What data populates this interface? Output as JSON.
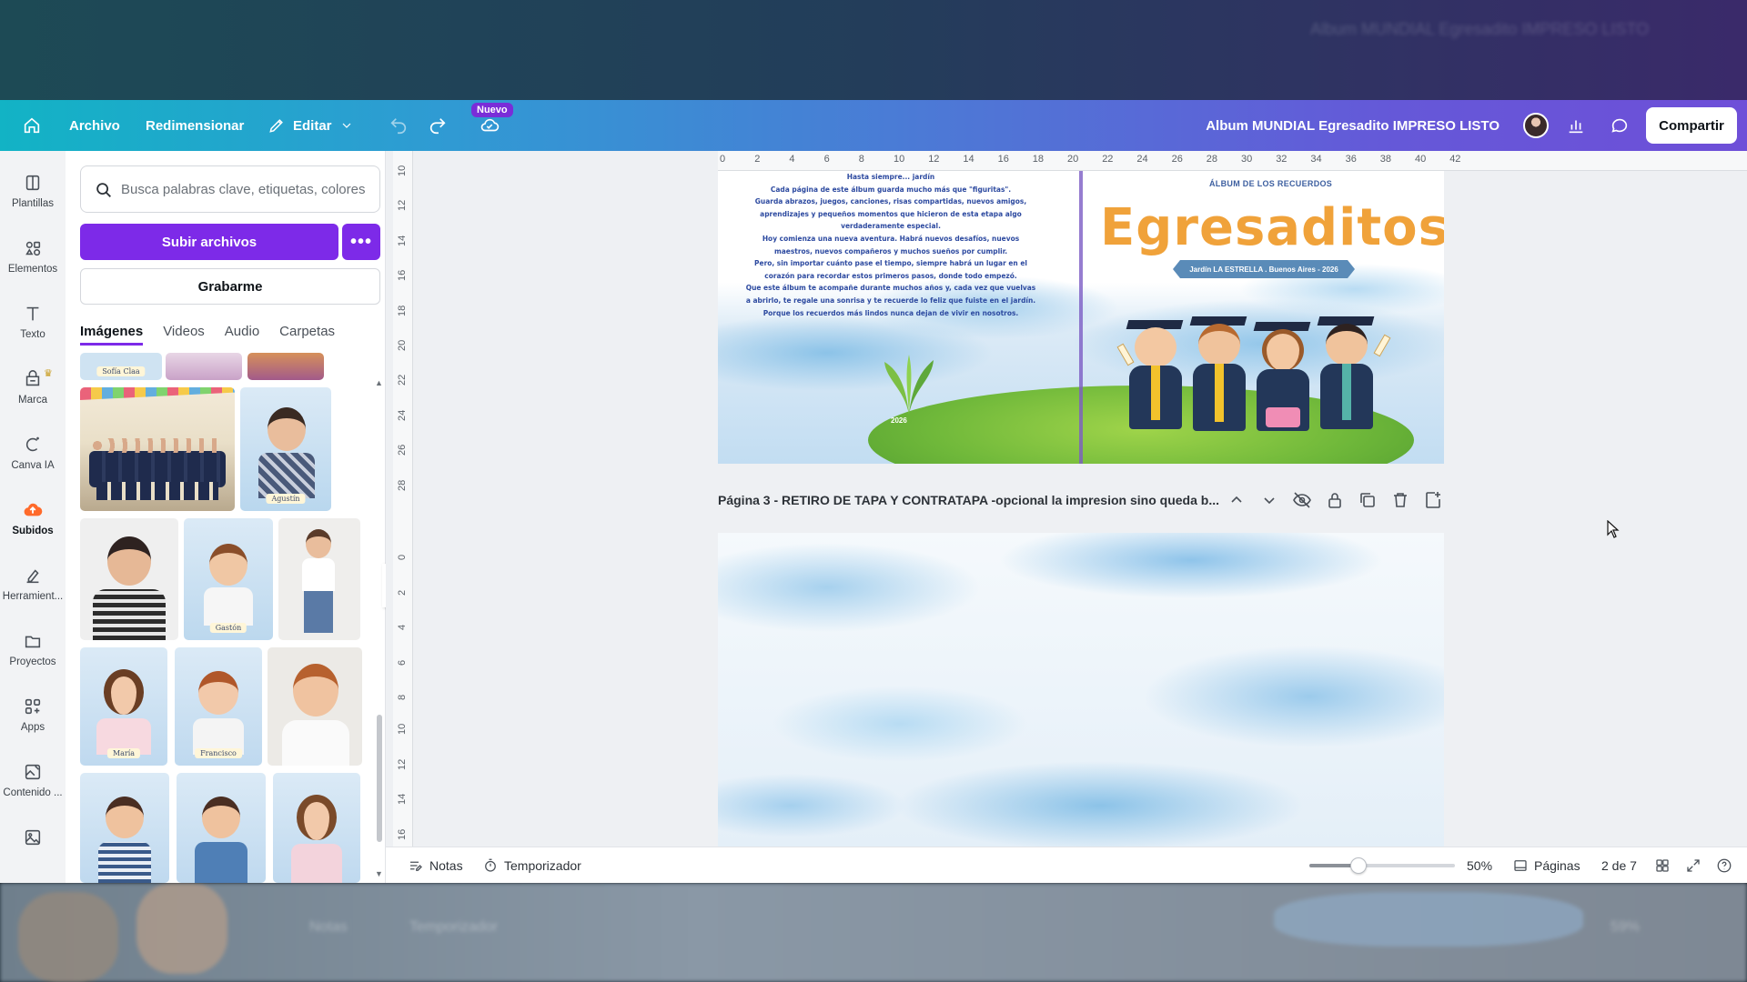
{
  "topbar": {
    "home_icon": "home-icon",
    "archivo": "Archivo",
    "redimensionar": "Redimensionar",
    "editar": "Editar",
    "nuevo_badge": "Nuevo",
    "doc_title": "Album MUNDIAL Egresadito IMPRESO LISTO",
    "share": "Compartir"
  },
  "rail": {
    "items": [
      {
        "label": "Plantillas",
        "icon": "templates-icon"
      },
      {
        "label": "Elementos",
        "icon": "elements-icon"
      },
      {
        "label": "Texto",
        "icon": "text-icon"
      },
      {
        "label": "Marca",
        "icon": "brand-icon"
      },
      {
        "label": "Canva IA",
        "icon": "ai-icon"
      },
      {
        "label": "Subidos",
        "icon": "upload-cloud-icon"
      },
      {
        "label": "Herramient...",
        "icon": "tools-icon"
      },
      {
        "label": "Proyectos",
        "icon": "folder-icon"
      },
      {
        "label": "Apps",
        "icon": "apps-icon"
      },
      {
        "label": "Contenido ...",
        "icon": "content-icon"
      },
      {
        "label": "",
        "icon": "image-icon"
      }
    ]
  },
  "panel": {
    "search_placeholder": "Busca palabras clave, etiquetas, colores",
    "upload": "Subir archivos",
    "more": "•••",
    "record": "Grabarme",
    "tabs": [
      "Imágenes",
      "Videos",
      "Audio",
      "Carpetas"
    ],
    "thumb_labels": [
      "Sofía Claa",
      "Agustín",
      "Gastón",
      "María",
      "Francisco"
    ]
  },
  "canvas": {
    "ruler_top": [
      "0",
      "2",
      "4",
      "6",
      "8",
      "10",
      "12",
      "14",
      "16",
      "18",
      "20",
      "22",
      "24",
      "26",
      "28",
      "30",
      "32",
      "34",
      "36",
      "38",
      "40",
      "42"
    ],
    "ruler_left": [
      "10",
      "12",
      "14",
      "16",
      "18",
      "20",
      "22",
      "24",
      "26",
      "28",
      "",
      "0",
      "2",
      "4",
      "6",
      "8",
      "10",
      "12",
      "14",
      "16"
    ],
    "poem": [
      "Hasta siempre... jardín",
      "Cada página de este álbum guarda mucho más que \"figuritas\".",
      "Guarda abrazos, juegos, canciones, risas compartidas, nuevos amigos,",
      "aprendizajes y pequeños momentos que hicieron de esta etapa algo",
      "verdaderamente especial.",
      "Hoy comienza una nueva aventura. Habrá nuevos desafíos, nuevos",
      "maestros, nuevos compañeros y muchos sueños por cumplir.",
      "Pero, sin importar cuánto pase el tiempo, siempre habrá un lugar en el",
      "corazón para recordar estos primeros pasos, donde todo empezó.",
      "Que este álbum te acompañe durante muchos años y, cada vez que vuelvas",
      "a abrirlo, te regale una sonrisa y te recuerde lo feliz que fuiste en el jardín.",
      "Porque los recuerdos más lindos nunca dejan de vivir en nosotros."
    ],
    "cover_kicker": "ÁLBUM DE LOS RECUERDOS",
    "cover_title": "Egresaditos",
    "cover_ribbon": "Jardín LA ESTRELLA . Buenos Aires - 2026",
    "year_tag": "2026",
    "page3_title": "Página 3 - RETIRO DE TAPA Y CONTRATAPA -opcional la impresion sino queda b..."
  },
  "bottombar": {
    "notes": "Notas",
    "timer": "Temporizador",
    "zoom": "50%",
    "zoom_value": 0.5,
    "pages": "Páginas",
    "page_count": "2 de 7"
  },
  "background": {
    "ghost_doc_title": "Album MUNDIAL Egresadito IMPRESO LISTO",
    "ghost_notes": "Notas",
    "ghost_timer": "Temporizador",
    "ghost_zoom": "59%"
  },
  "colors": {
    "accent": "#7d2ae8",
    "topbar_start": "#12b3c5",
    "topbar_end": "#6e4fd8",
    "title_orange": "#f0a23a"
  }
}
